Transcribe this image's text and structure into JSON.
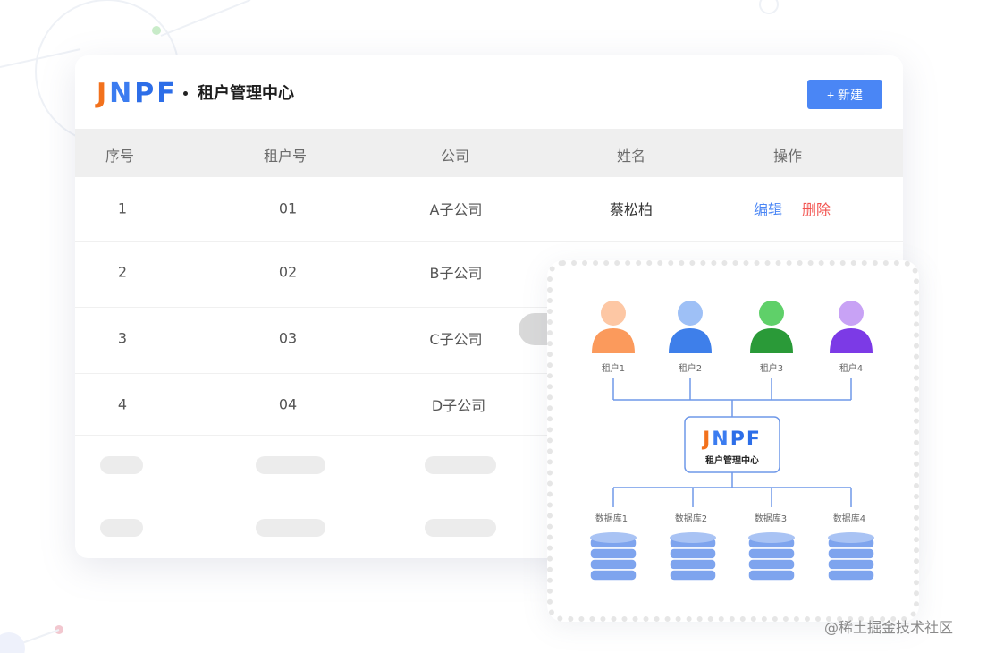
{
  "brand": {
    "logo_l1": "J",
    "logo_l2": "N",
    "logo_l3": "PF",
    "logo_text": "JNPF"
  },
  "header": {
    "title": "租户管理中心",
    "new_button": "+ 新建"
  },
  "table": {
    "columns": [
      "序号",
      "租户号",
      "公司",
      "姓名",
      "操作"
    ],
    "rows": [
      {
        "index": "1",
        "tenant_no": "01",
        "company": "A子公司",
        "name": "蔡松柏",
        "edit": "编辑",
        "delete": "删除"
      },
      {
        "index": "2",
        "tenant_no": "02",
        "company": "B子公司"
      },
      {
        "index": "3",
        "tenant_no": "03",
        "company": "C子公司"
      },
      {
        "index": "4",
        "tenant_no": "04",
        "company": "D子公司"
      }
    ]
  },
  "diagram": {
    "tenants": [
      {
        "label": "租户1",
        "head_color": "#fdc7a4",
        "body_color": "#fb9a5c"
      },
      {
        "label": "租户2",
        "head_color": "#9ec0f6",
        "body_color": "#3e7fea"
      },
      {
        "label": "租户3",
        "head_color": "#5fd069",
        "body_color": "#2a9a38"
      },
      {
        "label": "租户4",
        "head_color": "#c8a2f5",
        "body_color": "#7c3ae6"
      }
    ],
    "center_title": "租户管理中心",
    "databases": [
      {
        "label": "数据库1"
      },
      {
        "label": "数据库2"
      },
      {
        "label": "数据库3"
      },
      {
        "label": "数据库4"
      }
    ],
    "line_color": "#6f98e8",
    "db_color": "#7ea4ee"
  },
  "watermark": "@稀土掘金技术社区"
}
